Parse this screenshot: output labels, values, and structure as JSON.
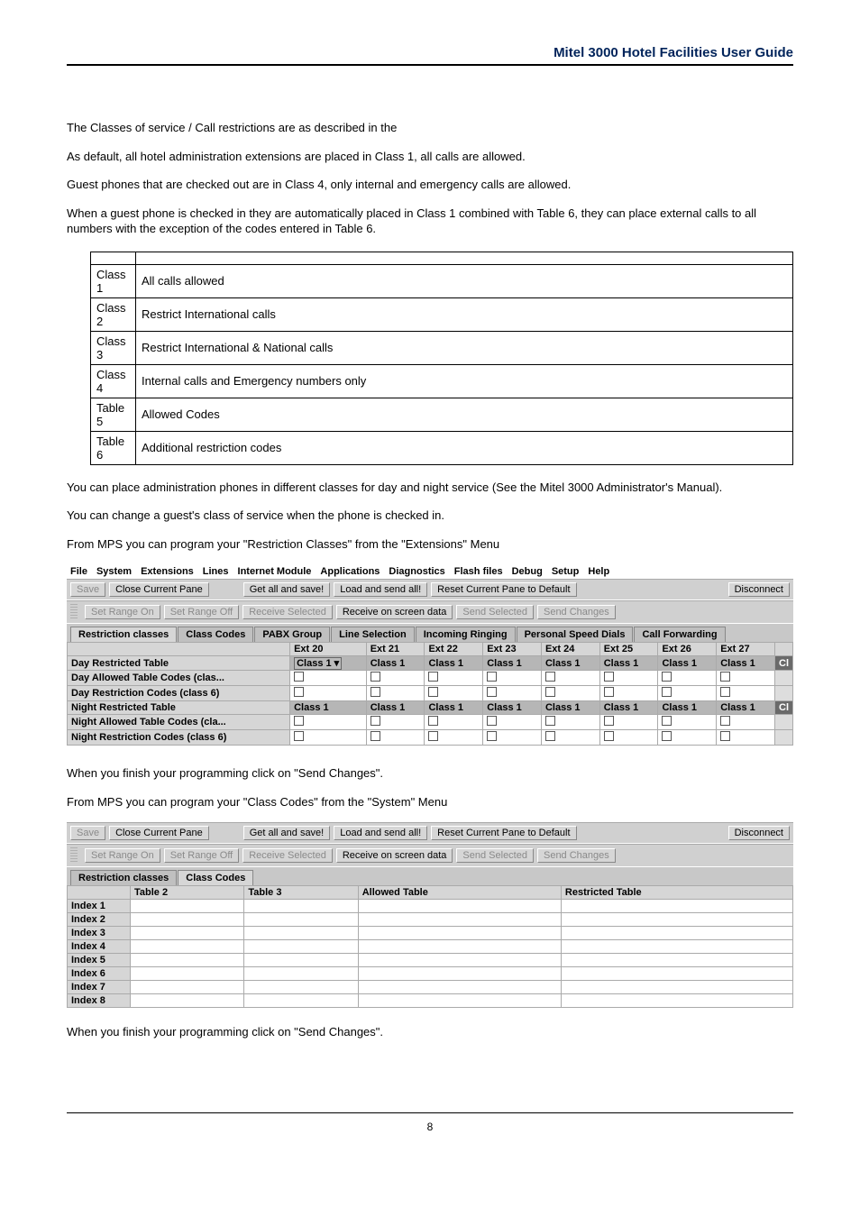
{
  "header": {
    "title": "Mitel 3000 Hotel Facilities User Guide"
  },
  "body": {
    "p1": "The Classes of service / Call restrictions are as described in the",
    "p2": "As default, all hotel administration extensions are placed in Class 1, all calls are allowed.",
    "p3": "Guest phones that are checked out are in Class 4, only internal and emergency calls are allowed.",
    "p4": "When a guest phone is checked in they are automatically placed in Class 1 combined with Table 6, they can place external calls to all numbers with the exception of the codes entered in Table 6.",
    "class_rows": [
      {
        "c": "Class 1",
        "d": "All calls allowed"
      },
      {
        "c": "Class 2",
        "d": "Restrict International calls"
      },
      {
        "c": "Class 3",
        "d": "Restrict International & National calls"
      },
      {
        "c": "Class 4",
        "d": "Internal calls and Emergency numbers only"
      },
      {
        "c": "Table 5",
        "d": "Allowed Codes"
      },
      {
        "c": "Table 6",
        "d": "Additional restriction codes"
      }
    ],
    "p5": "You can place administration phones in different classes for day and night service (See the Mitel 3000 Administrator's Manual).",
    "p6": "You can change a guest's class of service when the phone is checked in.",
    "p7": "From MPS you can program your \"Restriction Classes\" from the \"Extensions\" Menu",
    "p8": "When you finish your programming click on \"Send Changes\".",
    "p9": "From MPS you can program your \"Class Codes\" from the \"System\" Menu",
    "p10": "When you finish your programming click on \"Send Changes\"."
  },
  "panel1": {
    "menu": [
      "File",
      "System",
      "Extensions",
      "Lines",
      "Internet Module",
      "Applications",
      "Diagnostics",
      "Flash files",
      "Debug",
      "Setup",
      "Help"
    ],
    "toolbar1": {
      "save": "Save",
      "close": "Close Current Pane",
      "getall": "Get all and save!",
      "load": "Load and send all!",
      "reset": "Reset Current Pane to Default",
      "disc": "Disconnect"
    },
    "toolbar2": {
      "sron": "Set Range On",
      "sroff": "Set Range Off",
      "recvsel": "Receive Selected",
      "recvscr": "Receive on screen data",
      "sendsel": "Send Selected",
      "sendchg": "Send Changes"
    },
    "tabs": [
      "Restriction classes",
      "Class Codes",
      "PABX Group",
      "Line Selection",
      "Incoming Ringing",
      "Personal Speed Dials",
      "Call Forwarding"
    ],
    "ext_headers": [
      "Ext 20",
      "Ext 21",
      "Ext 22",
      "Ext 23",
      "Ext 24",
      "Ext 25",
      "Ext 26",
      "Ext 27"
    ],
    "rows": [
      {
        "label": "Day Restricted Table",
        "type": "dark",
        "cells": [
          "Class 1",
          "Class 1",
          "Class 1",
          "Class 1",
          "Class 1",
          "Class 1",
          "Class 1",
          "Class 1"
        ],
        "dd": true,
        "edge": "Cl"
      },
      {
        "label": "Day Allowed Table Codes (clas...",
        "type": "light",
        "cells": [
          "",
          "",
          "",
          "",
          "",
          "",
          "",
          ""
        ]
      },
      {
        "label": "Day Restriction Codes (class 6)",
        "type": "light",
        "cells": [
          "",
          "",
          "",
          "",
          "",
          "",
          "",
          ""
        ]
      },
      {
        "label": "Night Restricted Table",
        "type": "dark",
        "cells": [
          "Class 1",
          "Class 1",
          "Class 1",
          "Class 1",
          "Class 1",
          "Class 1",
          "Class 1",
          "Class 1"
        ],
        "edge": "Cl"
      },
      {
        "label": "Night Allowed Table Codes (cla...",
        "type": "light",
        "cells": [
          "",
          "",
          "",
          "",
          "",
          "",
          "",
          ""
        ]
      },
      {
        "label": "Night Restriction Codes (class 6)",
        "type": "light",
        "cells": [
          "",
          "",
          "",
          "",
          "",
          "",
          "",
          ""
        ]
      }
    ]
  },
  "panel2": {
    "tabs": [
      "Restriction classes",
      "Class Codes"
    ],
    "headers": [
      "Table 2",
      "Table 3",
      "Allowed Table",
      "Restricted Table"
    ],
    "rows": [
      "Index 1",
      "Index 2",
      "Index 3",
      "Index 4",
      "Index 5",
      "Index 6",
      "Index 7",
      "Index 8"
    ]
  },
  "footer": {
    "page": "8"
  }
}
